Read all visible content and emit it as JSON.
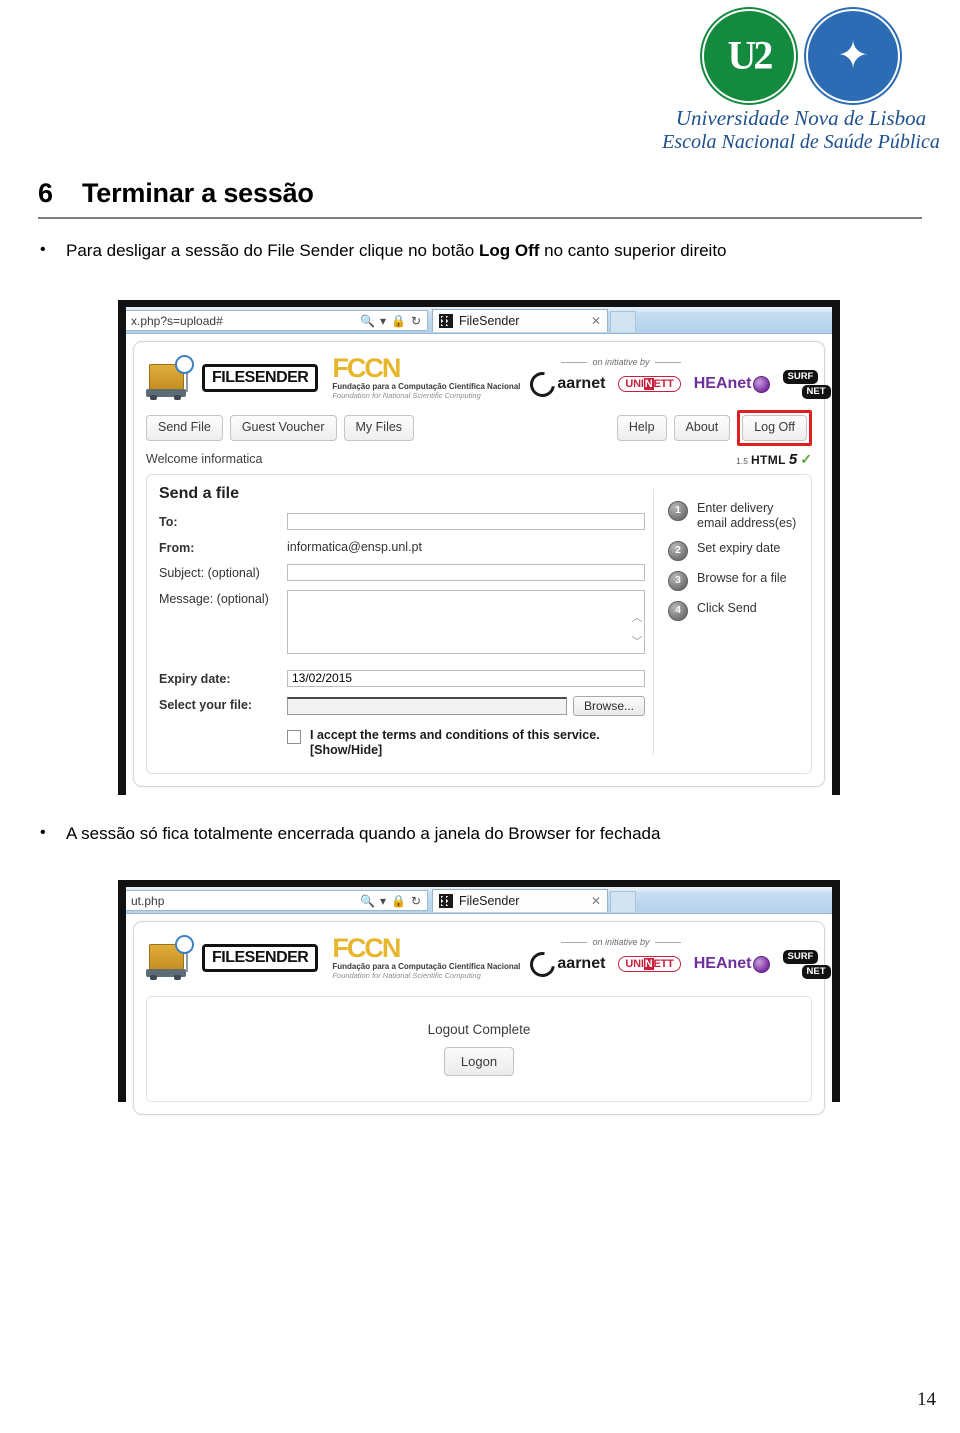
{
  "document": {
    "institution_line1": "Universidade Nova de Lisboa",
    "institution_line2": "Escola Nacional de Saúde Pública",
    "logo_unl_mark": "U2",
    "logo_ensp_mark": "✦",
    "page_number": "14"
  },
  "section": {
    "number": "6",
    "title": "Terminar a sessão"
  },
  "bullets": [
    {
      "marker": "•",
      "text_before": "Para desligar a sessão do File Sender clique no botão ",
      "bold": "Log Off",
      "text_after": " no canto superior direito"
    },
    {
      "marker": "•",
      "text": "A sessão só fica totalmente encerrada quando a janela do Browser for fechada"
    }
  ],
  "screenshot_upload": {
    "browser": {
      "url": "x.php?s=upload#",
      "search_icon": "search-icon",
      "dropdown_icon": "▾",
      "lock_icon": "🔒",
      "refresh_icon": "↻",
      "tab_title": "FileSender",
      "tab_close": "✕"
    },
    "brand": {
      "wordmark": "FILESENDER",
      "fccn_mark": "FCCN",
      "fccn_sub1": "Fundação para a Computação Científica Nacional",
      "fccn_sub2": "Foundation for National Scientific Computing",
      "initiative_label": "on initiative by",
      "partners": [
        "aarnet",
        "UNINETT",
        "HEAnet",
        "SURF NET"
      ],
      "uninett_prefix": "UNI",
      "uninett_block": "N",
      "uninett_suffix": "ETT",
      "surf_top": "SURF",
      "surf_bottom": "NET"
    },
    "nav": {
      "left_buttons": [
        "Send File",
        "Guest Voucher",
        "My Files"
      ],
      "right_buttons": [
        "Help",
        "About"
      ],
      "logoff_label": "Log Off"
    },
    "welcome": "Welcome informatica",
    "html5_badge": {
      "version": "1.5",
      "label": "HTML",
      "five": "5",
      "check": "✓"
    },
    "form": {
      "title": "Send a file",
      "to_label": "To:",
      "to_value": "",
      "from_label": "From:",
      "from_value": "informatica@ensp.unl.pt",
      "subject_label": "Subject: (optional)",
      "subject_value": "",
      "message_label": "Message: (optional)",
      "message_value": "",
      "expiry_label": "Expiry date:",
      "expiry_value": "13/02/2015",
      "file_label": "Select your file:",
      "file_value": "",
      "browse_label": "Browse...",
      "terms_line1": "I accept the terms and conditions of this service.",
      "terms_line2": "[Show/Hide]",
      "scroll_up": "︿",
      "scroll_down": "﹀"
    },
    "steps": [
      {
        "num": "1",
        "text": "Enter delivery email address(es)"
      },
      {
        "num": "2",
        "text": "Set expiry date"
      },
      {
        "num": "3",
        "text": "Browse for a file"
      },
      {
        "num": "4",
        "text": "Click Send"
      }
    ]
  },
  "screenshot_logout": {
    "browser": {
      "url": "ut.php",
      "tab_title": "FileSender",
      "tab_close": "✕"
    },
    "message": "Logout Complete",
    "logon_label": "Logon"
  },
  "colors": {
    "highlight_red": "#e02020",
    "brand_yellow": "#e8b62c",
    "unl_green": "#138a3e",
    "ensp_blue": "#2b6cb4",
    "institution_text": "#1d4f8c"
  }
}
